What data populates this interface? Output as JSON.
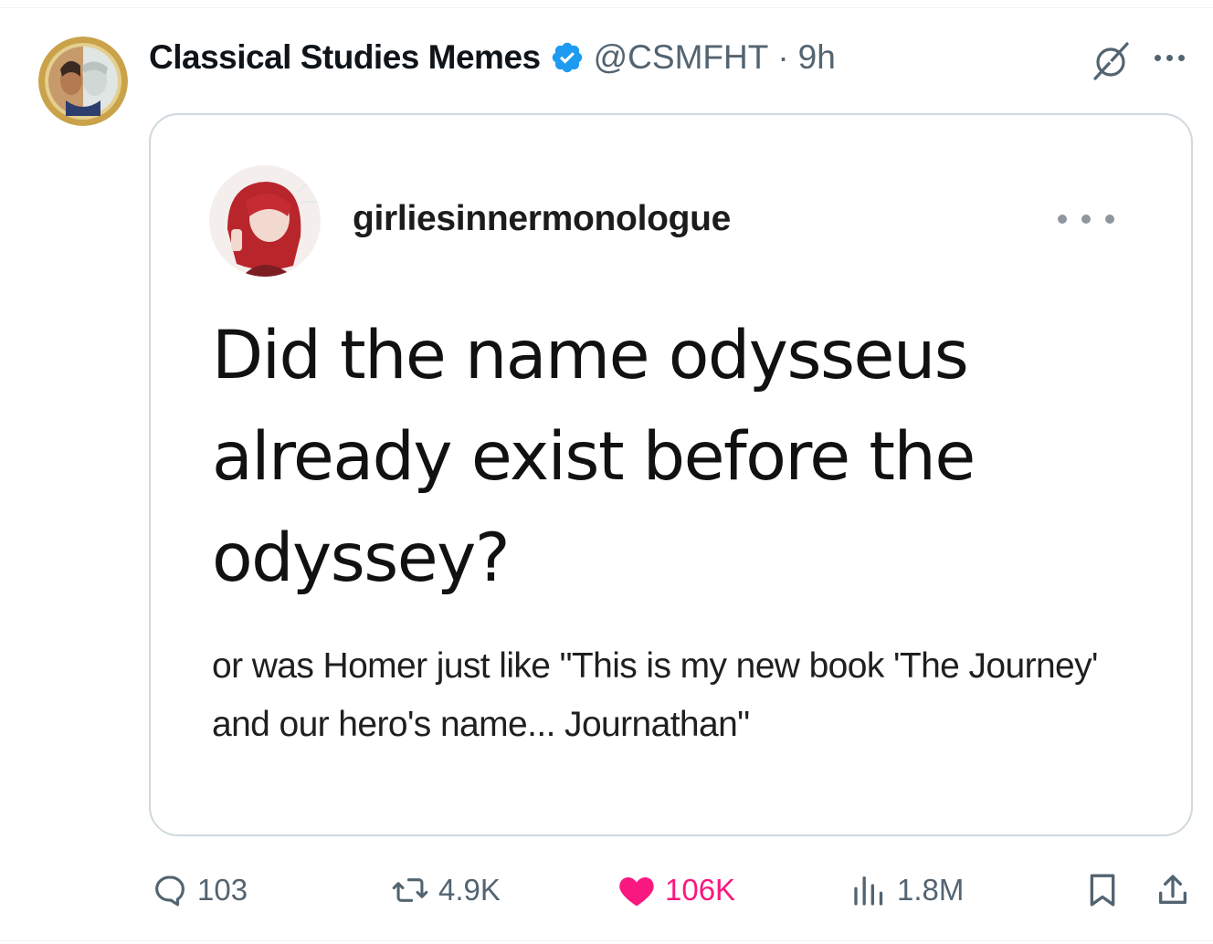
{
  "tweet": {
    "display_name": "Classical Studies Memes",
    "handle": "@CSMFHT",
    "separator": "·",
    "time": "9h",
    "verified": true,
    "icons": {
      "verified": "verified-badge-icon",
      "grok": "grok-icon",
      "more": "more-icon"
    }
  },
  "embedded_post": {
    "username": "girliesinnermonologue",
    "question": "Did the name odysseus already exist before the odyssey?",
    "body": "or was Homer just like \"This is my new book 'The Journey' and our hero's name... Journathan\""
  },
  "actions": {
    "replies": "103",
    "reposts": "4.9K",
    "likes": "106K",
    "views": "1.8M",
    "icons": [
      "reply-icon",
      "repost-icon",
      "like-icon",
      "views-icon",
      "bookmark-icon",
      "share-icon"
    ]
  },
  "colors": {
    "text": "#0f1419",
    "secondary": "#536471",
    "verified": "#1d9bf0",
    "like": "#f91880",
    "border": "#cfd9de"
  }
}
